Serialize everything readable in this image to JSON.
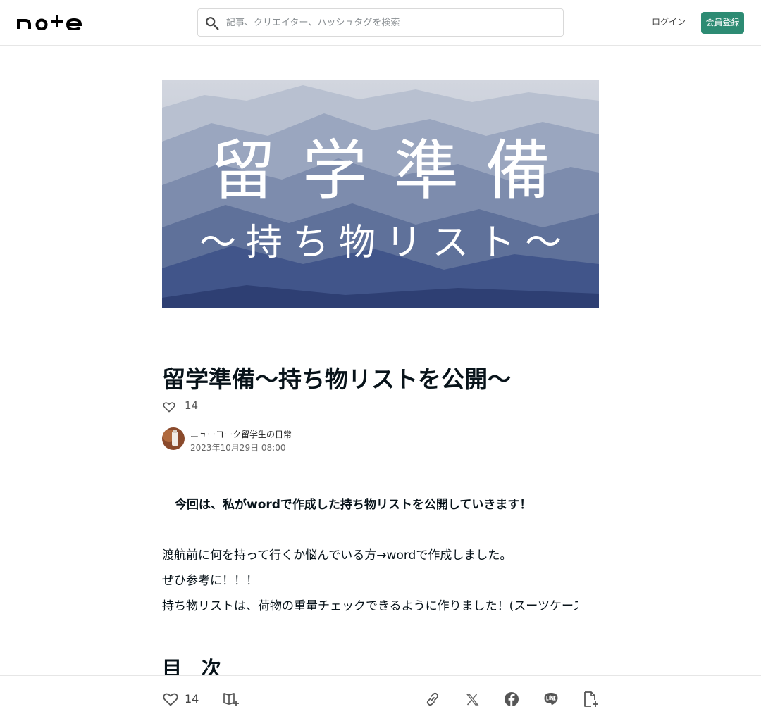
{
  "header": {
    "logo_text": "note",
    "search_placeholder": "記事、クリエイター、ハッシュタグを検索",
    "login_label": "ログイン",
    "signup_label": "会員登録"
  },
  "hero": {
    "title": "留学準備",
    "subtitle": "〜持ち物リスト〜"
  },
  "article": {
    "title": "留学準備〜持ち物リストを公開〜",
    "like_count": "14",
    "author_name": "ニューヨーク留学生の日常",
    "date": "2023年10月29日 08:00",
    "intro_bold": "今回は、私がwordで作成した持ち物リストを公開していきます！",
    "para1": "渡航前に何を持って行くか悩んでいる方→wordで作成しました。",
    "para2": "ぜひ参考に！！！",
    "para3_a": "持ち物リストは、",
    "para3_strike": "荷物の重量",
    "para3_b": "チェックできるように作りました！(スーツケースの重さを気にしながらパッキングすると楽です！",
    "heading": "目　次"
  },
  "bottombar": {
    "like_count": "14",
    "icons": [
      "heart-icon",
      "magazine-add-icon",
      "link-icon",
      "x-icon",
      "facebook-icon",
      "line-icon",
      "note-embed-icon"
    ]
  },
  "colors": {
    "accent": "#2d8b73",
    "text": "#08131a",
    "border": "#e6e6e6"
  }
}
